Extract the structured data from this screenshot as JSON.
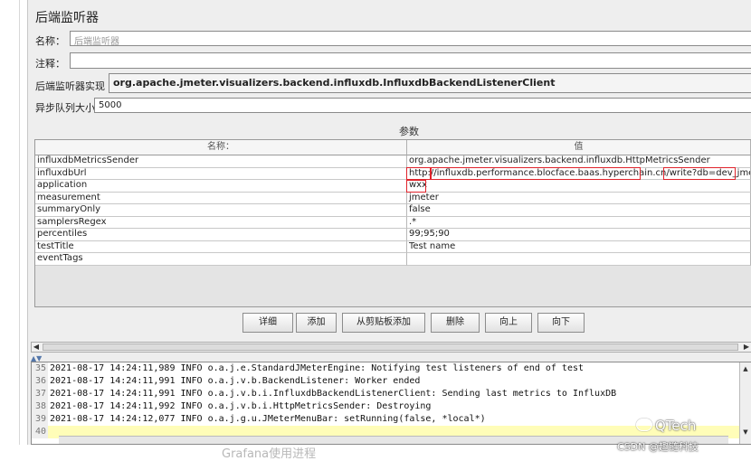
{
  "panel": {
    "title": "后端监听器",
    "name_label": "名称：",
    "name_value": "后端监听器",
    "comment_label": "注释：",
    "comment_value": "",
    "impl_label": "后端监听器实现",
    "impl_value": "org.apache.jmeter.visualizers.backend.influxdb.InfluxdbBackendListenerClient",
    "queue_label": "异步队列大小",
    "queue_value": "5000",
    "params_label": "参数"
  },
  "table": {
    "headers": [
      "名称：",
      "值"
    ],
    "rows": [
      {
        "name": "influxdbMetricsSender",
        "value": "org.apache.jmeter.visualizers.backend.influxdb.HttpMetricsSender"
      },
      {
        "name": "influxdbUrl",
        "value": "http://influxdb.performance.blocface.baas.hyperchain.cn/write?db=dev_jmeter"
      },
      {
        "name": "application",
        "value": "wxx"
      },
      {
        "name": "measurement",
        "value": "jmeter"
      },
      {
        "name": "summaryOnly",
        "value": "false"
      },
      {
        "name": "samplersRegex",
        "value": ".*"
      },
      {
        "name": "percentiles",
        "value": "99;95;90"
      },
      {
        "name": "testTitle",
        "value": "Test name"
      },
      {
        "name": "eventTags",
        "value": ""
      }
    ]
  },
  "buttons": {
    "detail": "详细",
    "add": "添加",
    "add_clipboard": "从剪贴板添加",
    "delete": "删除",
    "up": "向上",
    "down": "向下"
  },
  "log": {
    "lines": [
      {
        "no": "35",
        "text": "2021-08-17 14:24:11,989 INFO o.a.j.e.StandardJMeterEngine: Notifying test listeners of end of test"
      },
      {
        "no": "36",
        "text": "2021-08-17 14:24:11,991 INFO o.a.j.v.b.BackendListener: Worker ended"
      },
      {
        "no": "37",
        "text": "2021-08-17 14:24:11,991 INFO o.a.j.v.b.i.InfluxdbBackendListenerClient: Sending last metrics to InfluxDB"
      },
      {
        "no": "38",
        "text": "2021-08-17 14:24:11,992 INFO o.a.j.v.b.i.HttpMetricsSender: Destroying"
      },
      {
        "no": "39",
        "text": "2021-08-17 14:24:12,077 INFO o.a.j.g.u.JMeterMenuBar: setRunning(false, *local*)"
      },
      {
        "no": "40",
        "text": ""
      }
    ]
  },
  "caption": "Grafana使用进程",
  "watermark": {
    "brand": "QTech",
    "source": "CSDN @趣链科技"
  },
  "colors": {
    "highlight_box": "#e0232b",
    "current_line": "#fffdb8"
  }
}
